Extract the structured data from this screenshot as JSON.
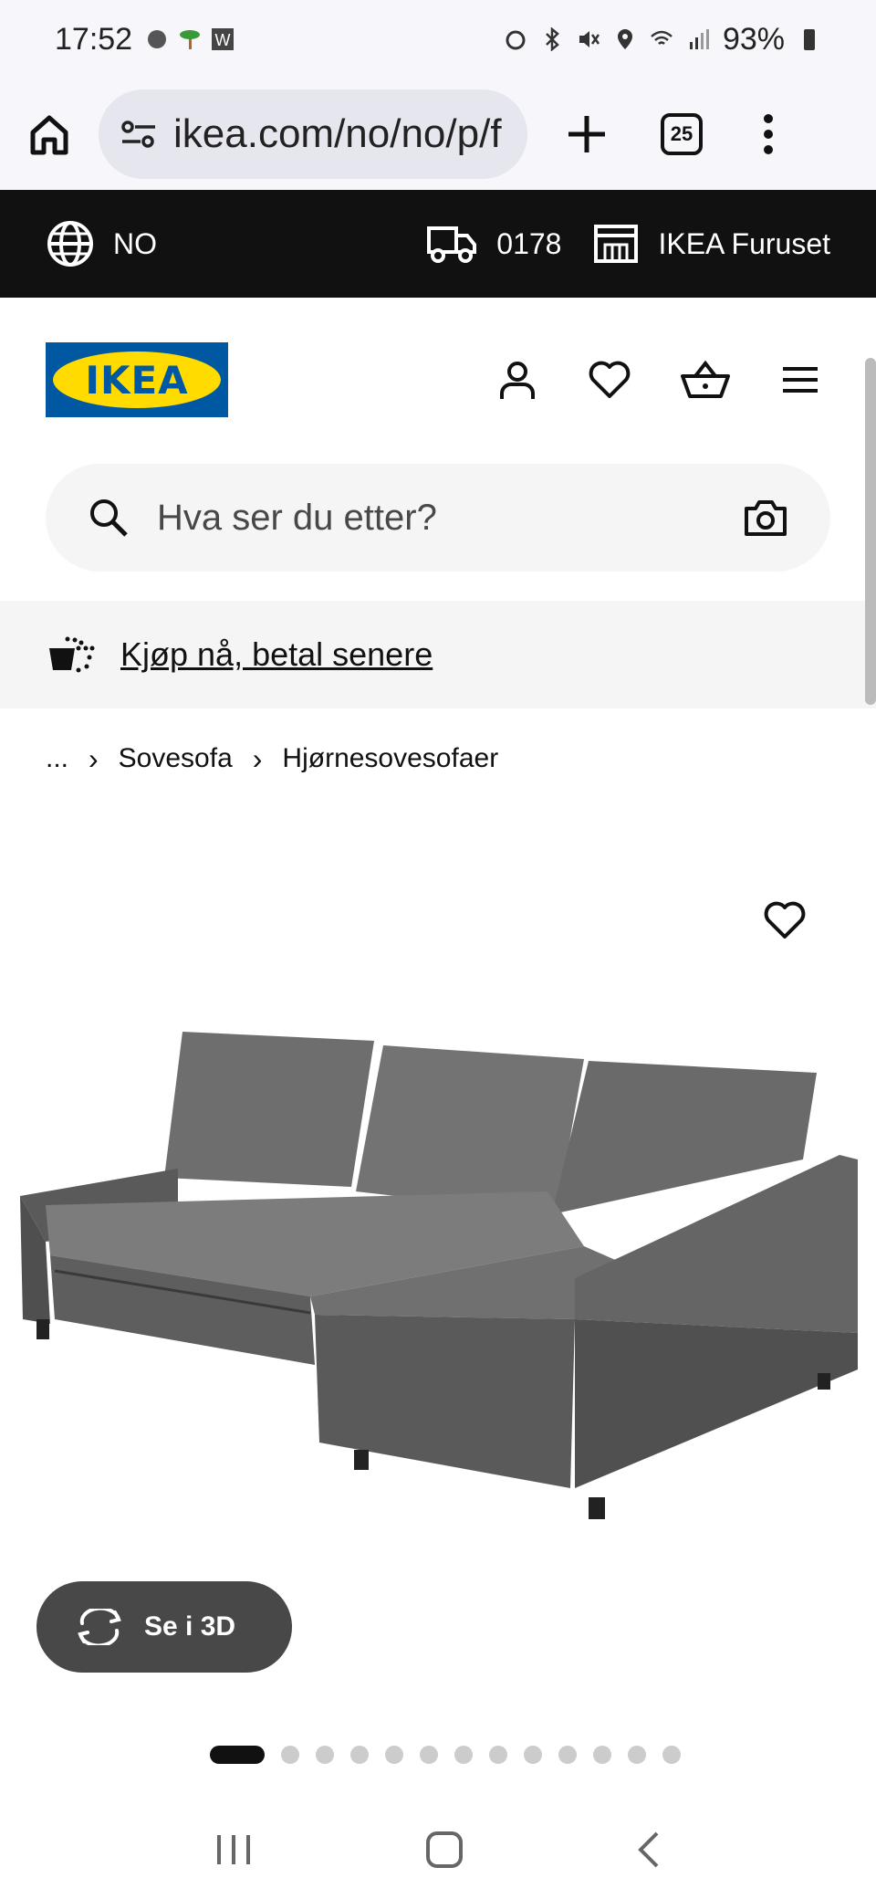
{
  "status": {
    "time": "17:52",
    "battery": "93%"
  },
  "browser": {
    "url": "ikea.com/no/no/p/f",
    "tab_count": "25"
  },
  "topbar": {
    "country": "NO",
    "delivery_code": "0178",
    "store": "IKEA Furuset"
  },
  "header": {
    "logo_text": "IKEA",
    "brand_colors": {
      "blue": "#0058a3",
      "yellow": "#ffdb00"
    }
  },
  "search": {
    "placeholder": "Hva ser du etter?"
  },
  "promo": {
    "label": "Kjøp nå, betal senere"
  },
  "breadcrumb": {
    "items": [
      "...",
      "Sovesofa",
      "Hjørnesovesofaer"
    ]
  },
  "product": {
    "view_3d_label": "Se i 3D",
    "image_count": 13,
    "active_image": 1
  },
  "icons": {
    "home": "home-icon",
    "tune": "site-settings-icon",
    "add": "plus-icon",
    "menu": "kebab-menu-icon",
    "globe": "globe-icon",
    "truck": "truck-icon",
    "store": "store-icon",
    "account": "account-icon",
    "favorite": "heart-icon",
    "cart": "basket-icon",
    "hamburger": "hamburger-icon",
    "search": "search-icon",
    "camera": "camera-icon",
    "pay_later": "basket-dotted-icon",
    "rotate": "rotate-3d-icon"
  }
}
